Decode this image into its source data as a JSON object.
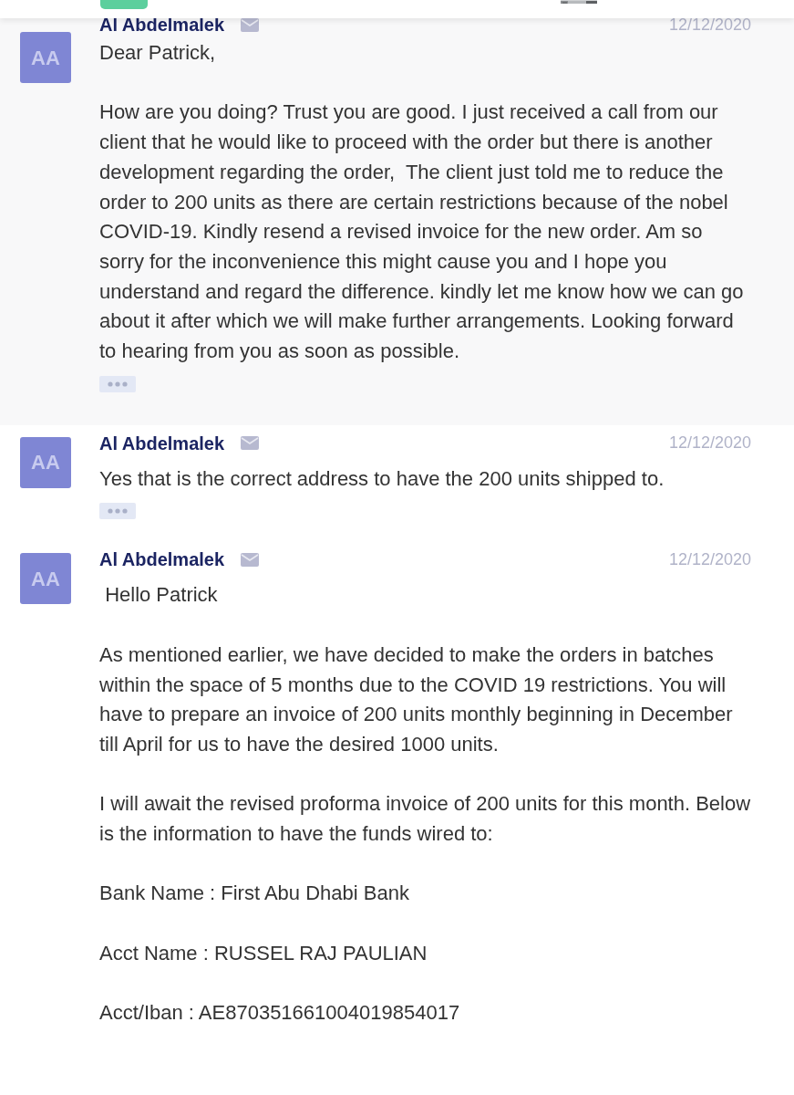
{
  "messages": [
    {
      "avatar": "AA",
      "sender": "Al Abdelmalek",
      "date": "12/12/2020",
      "highlighted": true,
      "paragraphs": [
        "Dear Patrick,",
        "How are you doing? Trust you are good. I just received a call from our client that he would like to proceed with the order but there is another development regarding the order,  The client just told me to reduce the order to 200 units as there are certain restrictions because of the nobel COVID-19. Kindly resend a revised invoice for the new order. Am so sorry for the inconvenience this might cause you and I hope you understand and regard the difference. kindly let me know how we can go about it after which we will make further arrangements. Looking forward to hearing from you as soon as possible."
      ],
      "more_button": true
    },
    {
      "avatar": "AA",
      "sender": "Al Abdelmalek",
      "date": "12/12/2020",
      "highlighted": false,
      "paragraphs": [
        "Yes that is the correct address to have the 200 units shipped to."
      ],
      "more_button": true
    },
    {
      "avatar": "AA",
      "sender": "Al Abdelmalek",
      "date": "12/12/2020",
      "highlighted": false,
      "paragraphs": [
        " Hello Patrick",
        "As mentioned earlier, we have decided to make the orders in batches within the space of 5 months due to the COVID 19 restrictions. You will have to prepare an invoice of 200 units monthly beginning in December till April for us to have the desired 1000 units.",
        "I will await the revised proforma invoice of 200 units for this month. Below is the information to have the funds wired to:",
        "Bank Name : First Abu Dhabi Bank",
        "Acct Name : RUSSEL RAJ PAULIAN",
        "Acct/Iban : AE870351661004019854017"
      ],
      "more_button": false
    }
  ]
}
